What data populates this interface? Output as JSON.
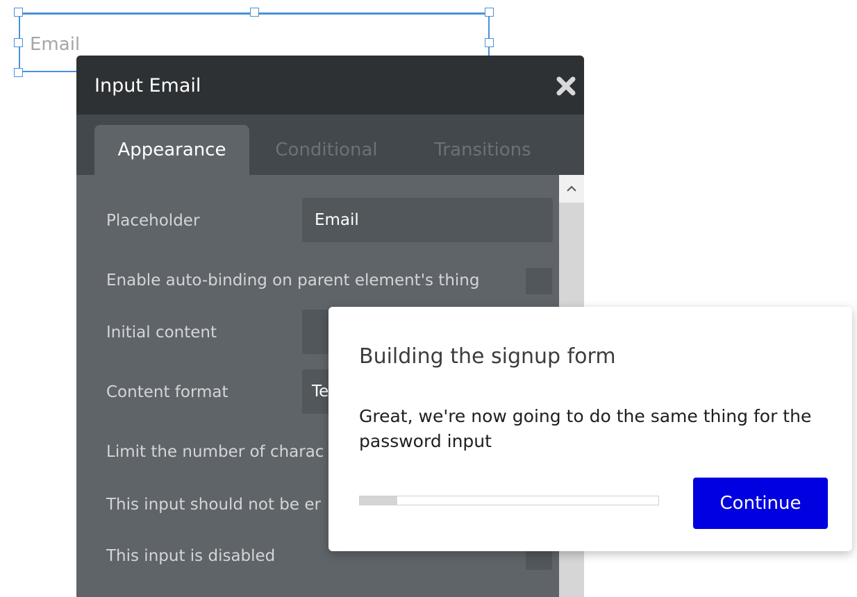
{
  "canvas": {
    "selected_input_placeholder": "Email"
  },
  "panel": {
    "title": "Input Email",
    "close_icon": "close-x-icon",
    "tabs": [
      {
        "label": "Appearance",
        "active": true
      },
      {
        "label": "Conditional",
        "active": false
      },
      {
        "label": "Transitions",
        "active": false
      }
    ],
    "properties": {
      "placeholder_label": "Placeholder",
      "placeholder_value": "Email",
      "auto_binding_label": "Enable auto-binding on parent element's thing",
      "initial_content_label": "Initial content",
      "content_format_label": "Content format",
      "content_format_value": "Te",
      "limit_chars_label": "Limit the number of charac",
      "not_empty_label": "This input should not be er",
      "disabled_label": "This input is disabled"
    }
  },
  "tour": {
    "title": "Building the signup form",
    "body": "Great, we're now going to do the same thing for the password input",
    "progress_fraction": 0.125,
    "continue_label": "Continue"
  },
  "colors": {
    "selection_blue": "#4a90d9",
    "panel_bg": "#5f6469",
    "panel_header": "#2d3134",
    "continue_blue": "#0000e0"
  }
}
